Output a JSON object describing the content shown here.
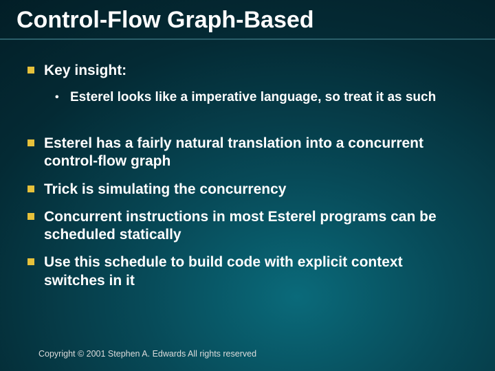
{
  "title": "Control-Flow Graph-Based",
  "bullets": {
    "b1": "Key insight:",
    "b1_sub": "Esterel looks like a imperative language, so treat it as such",
    "b2": "Esterel has a fairly natural translation into a concurrent control-flow graph",
    "b3": "Trick is simulating the concurrency",
    "b4": "Concurrent instructions in most Esterel programs can be scheduled statically",
    "b5": "Use this schedule to build code with explicit context switches in it"
  },
  "footer": "Copyright © 2001 Stephen A. Edwards  All rights reserved"
}
